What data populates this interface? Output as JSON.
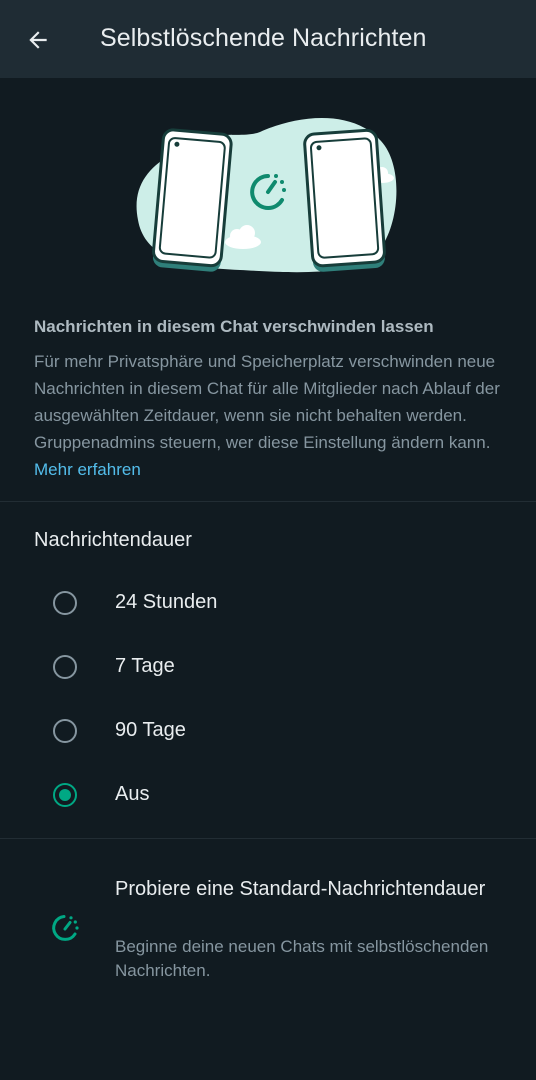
{
  "header": {
    "title": "Selbstlöschende Nachrichten",
    "back_icon": "arrow-left-icon"
  },
  "info": {
    "title": "Nachrichten in diesem Chat verschwinden lassen",
    "body": "Für mehr Privatsphäre und Speicherplatz verschwinden neue Nachrichten in diesem Chat für alle Mitglieder nach Ablauf der ausgewählten Zeitdauer, wenn sie nicht behalten werden. Gruppenadmins steuern, wer diese Einstellung ändern kann.",
    "link": "Mehr erfahren"
  },
  "duration": {
    "label": "Nachrichtendauer",
    "options": [
      {
        "label": "24 Stunden",
        "selected": false
      },
      {
        "label": "7 Tage",
        "selected": false
      },
      {
        "label": "90 Tage",
        "selected": false
      },
      {
        "label": "Aus",
        "selected": true
      }
    ]
  },
  "promo": {
    "title": "Probiere eine Standard-Nachrichtendauer",
    "subtitle": "Beginne deine neuen Chats mit selbstlöschenden Nachrichten.",
    "icon": "timer-icon"
  },
  "colors": {
    "background": "#111b21",
    "header": "#1f2c34",
    "accent": "#00a884",
    "link": "#53bdeb",
    "illustration_bg": "#cdeee8"
  }
}
